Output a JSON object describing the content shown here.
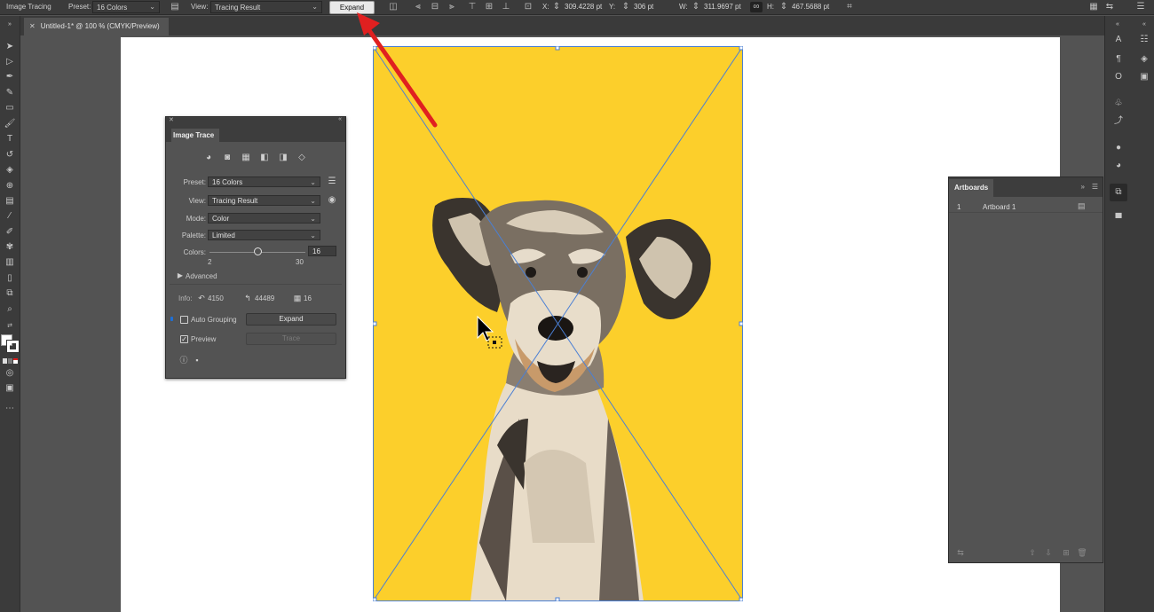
{
  "control_bar": {
    "panel_title": "Image Tracing",
    "preset_label": "Preset:",
    "preset_value": "16 Colors",
    "view_label": "View:",
    "view_value": "Tracing Result",
    "expand_label": "Expand",
    "x_label": "X:",
    "x_value": "309.4228 pt",
    "y_label": "Y:",
    "y_value": "306 pt",
    "w_label": "W:",
    "w_value": "311.9697 pt",
    "h_label": "H:",
    "h_value": "467.5688 pt"
  },
  "document": {
    "tab_title": "Untitled-1* @ 100 % (CMYK/Preview)"
  },
  "image_trace": {
    "title": "Image Trace",
    "preset_label": "Preset:",
    "preset_value": "16 Colors",
    "view_label": "View:",
    "view_value": "Tracing Result",
    "mode_label": "Mode:",
    "mode_value": "Color",
    "palette_label": "Palette:",
    "palette_value": "Limited",
    "colors_label": "Colors:",
    "colors_value": "16",
    "colors_min": "2",
    "colors_max": "30",
    "colors_fraction": 0.5,
    "advanced_label": "Advanced",
    "info_label": "Info:",
    "info_paths": "4150",
    "info_anchors": "44489",
    "info_colors": "16",
    "auto_grouping_label": "Auto Grouping",
    "auto_grouping_checked": false,
    "expand_label": "Expand",
    "preview_label": "Preview",
    "preview_checked": true,
    "trace_label": "Trace"
  },
  "artboards_panel": {
    "title": "Artboards",
    "items": [
      {
        "number": "1",
        "name": "Artboard 1"
      }
    ]
  },
  "colors": {
    "accent_arrow": "#e02020",
    "selection": "#4a7fd4",
    "image_background": "#fccf2b"
  }
}
